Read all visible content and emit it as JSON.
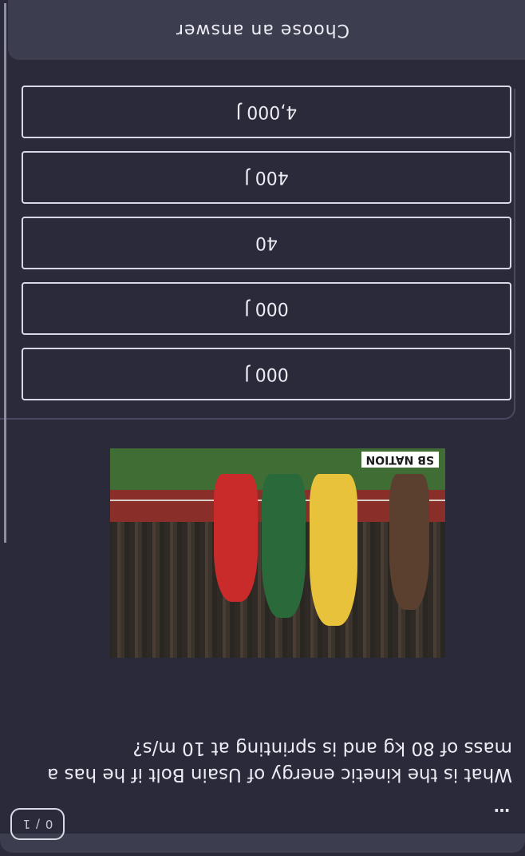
{
  "header": {
    "more_label": "…",
    "progress": "0 / 1"
  },
  "question": {
    "text": "What is the kinetic energy of Usain Bolt if he has a mass of 80 kg and is sprinting at 10 m/s?"
  },
  "image": {
    "logo_text": "SB NATION"
  },
  "answers": {
    "options": [
      "4,000 J",
      "400 J",
      "40",
      "000 J",
      "000 J"
    ]
  },
  "footer": {
    "choose_label": "Choose an answer"
  },
  "colors": {
    "background": "#2b2a3a",
    "panel": "#3d3d50",
    "border": "#d9d9e6",
    "text": "#ececf4"
  }
}
